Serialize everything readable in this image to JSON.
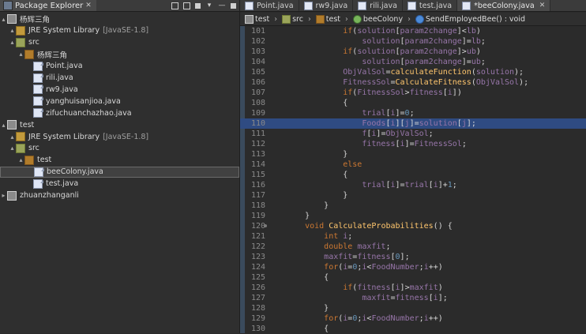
{
  "left": {
    "tab_title": "Package Explorer",
    "tree": [
      {
        "name": "杨辉三角",
        "type": "project",
        "indent": 0,
        "expanded": true
      },
      {
        "name": "JRE System Library",
        "type": "lib",
        "indent": 1,
        "suffix": "[JavaSE-1.8]",
        "expanded": true
      },
      {
        "name": "src",
        "type": "src",
        "indent": 1,
        "expanded": true
      },
      {
        "name": "杨辉三角",
        "type": "pkg",
        "indent": 2,
        "expanded": true
      },
      {
        "name": "Point.java",
        "type": "java",
        "indent": 3
      },
      {
        "name": "rili.java",
        "type": "java",
        "indent": 3
      },
      {
        "name": "rw9.java",
        "type": "java",
        "indent": 3
      },
      {
        "name": "yanghuisanjioa.java",
        "type": "java",
        "indent": 3
      },
      {
        "name": "zifuchuanchazhao.java",
        "type": "java",
        "indent": 3
      },
      {
        "name": "test",
        "type": "project",
        "indent": 0,
        "expanded": true
      },
      {
        "name": "JRE System Library",
        "type": "lib",
        "indent": 1,
        "suffix": "[JavaSE-1.8]",
        "expanded": true
      },
      {
        "name": "src",
        "type": "src",
        "indent": 1,
        "expanded": true
      },
      {
        "name": "test",
        "type": "pkg",
        "indent": 2,
        "expanded": true
      },
      {
        "name": "beeColony.java",
        "type": "java",
        "indent": 3,
        "selected": true
      },
      {
        "name": "test.java",
        "type": "java",
        "indent": 3
      },
      {
        "name": "zhuanzhanganli",
        "type": "project",
        "indent": 0,
        "expanded": false
      }
    ]
  },
  "editor": {
    "tabs": [
      {
        "label": "Point.java",
        "active": false
      },
      {
        "label": "rw9.java",
        "active": false
      },
      {
        "label": "rili.java",
        "active": false
      },
      {
        "label": "test.java",
        "active": false
      },
      {
        "label": "*beeColony.java",
        "active": true
      }
    ],
    "breadcrumb": [
      {
        "label": "test",
        "icon": "proj"
      },
      {
        "label": "src",
        "icon": "src"
      },
      {
        "label": "test",
        "icon": "pkg"
      },
      {
        "label": "beeColony",
        "icon": "class"
      },
      {
        "label": "SendEmployedBee() : void",
        "icon": "method"
      }
    ],
    "lines": [
      {
        "n": "101",
        "t": "            if(solution[param2change]<lb)"
      },
      {
        "n": "102",
        "t": "                solution[param2change]=lb;"
      },
      {
        "n": "103",
        "t": "            if(solution[param2change]>ub)"
      },
      {
        "n": "104",
        "t": "                solution[param2change]=ub;"
      },
      {
        "n": "105",
        "t": "            ObjValSol=calculateFunction(solution);"
      },
      {
        "n": "106",
        "t": "            FitnessSol=CalculateFitness(ObjValSol);"
      },
      {
        "n": "107",
        "t": "            if(FitnessSol>fitness[i])"
      },
      {
        "n": "108",
        "t": "            {"
      },
      {
        "n": "109",
        "t": "                trial[i]=0;"
      },
      {
        "n": "110",
        "t": "                Foods[i][j]=solution[j];",
        "hl": true
      },
      {
        "n": "111",
        "t": "                f[i]=ObjValSol;"
      },
      {
        "n": "112",
        "t": "                fitness[i]=FitnessSol;"
      },
      {
        "n": "113",
        "t": "            }"
      },
      {
        "n": "114",
        "t": "            else"
      },
      {
        "n": "115",
        "t": "            {"
      },
      {
        "n": "116",
        "t": "                trial[i]=trial[i]+1;"
      },
      {
        "n": "117",
        "t": "            }"
      },
      {
        "n": "118",
        "t": "        }"
      },
      {
        "n": "119",
        "t": "    }"
      },
      {
        "n": "120",
        "t": "    void CalculateProbabilities() {",
        "marker": true
      },
      {
        "n": "121",
        "t": "        int i;"
      },
      {
        "n": "122",
        "t": "        double maxfit;"
      },
      {
        "n": "123",
        "t": "        maxfit=fitness[0];"
      },
      {
        "n": "124",
        "t": "        for(i=0;i<FoodNumber;i++)"
      },
      {
        "n": "125",
        "t": "        {"
      },
      {
        "n": "126",
        "t": "            if(fitness[i]>maxfit)"
      },
      {
        "n": "127",
        "t": "                maxfit=fitness[i];"
      },
      {
        "n": "128",
        "t": "        }"
      },
      {
        "n": "129",
        "t": "        for(i=0;i<FoodNumber;i++)"
      },
      {
        "n": "130",
        "t": "        {"
      }
    ]
  }
}
